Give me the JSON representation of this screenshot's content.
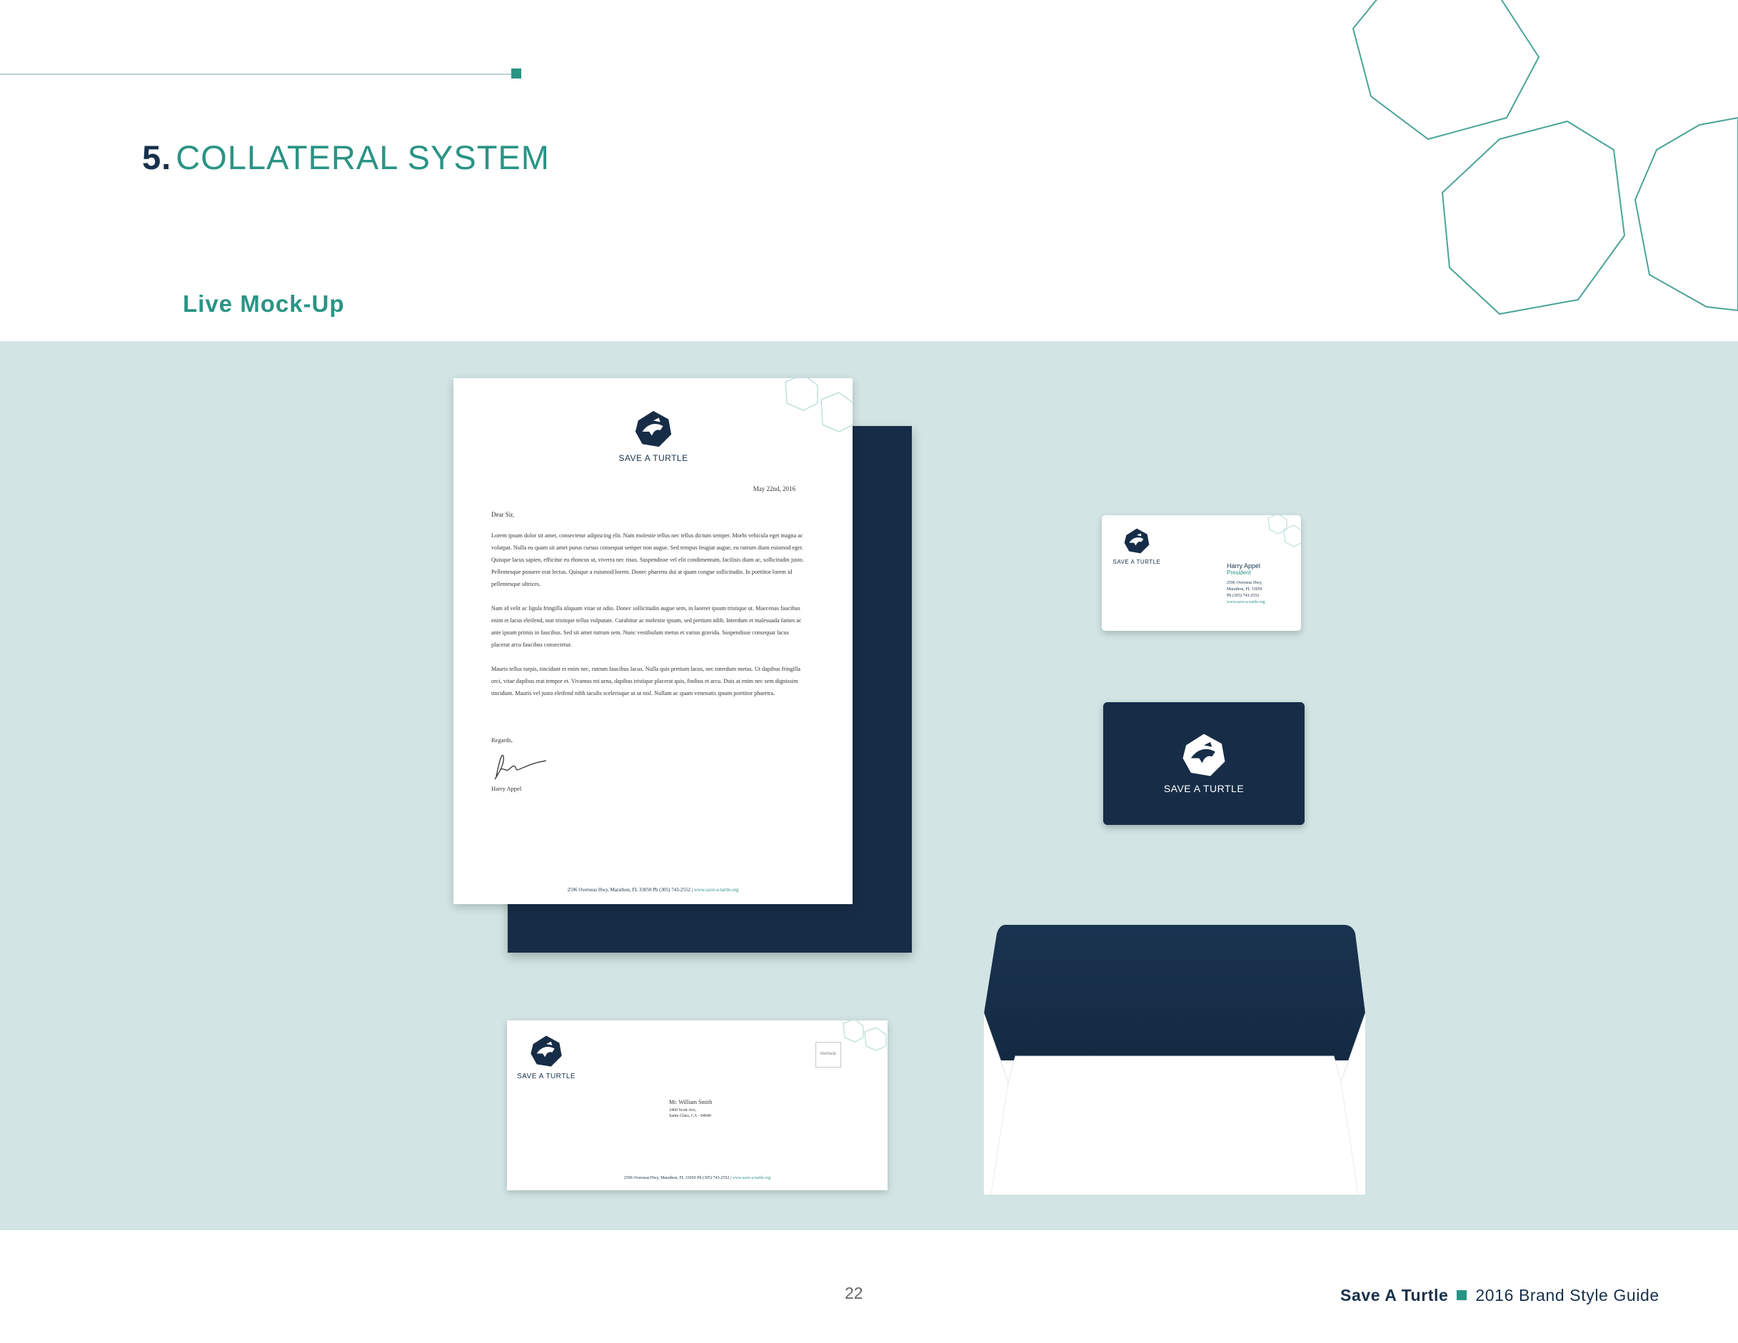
{
  "section": {
    "number": "5.",
    "title": "COLLATERAL SYSTEM"
  },
  "subtitle": "Live Mock-Up",
  "colors": {
    "navy": "#172d47",
    "teal": "#2a9485",
    "mockup_background": "#d2e5e4"
  },
  "brand_name": "SAVE A TURTLE",
  "letterhead": {
    "date": "May 22nd, 2016",
    "salutation": "Dear Sir,",
    "paragraphs": [
      "Lorem ipsum dolor sit amet, consectetur adipiscing elit. Nam molestie tellus nec tellus dictum semper. Morbi vehicula eget magna ac volutpat. Nulla eu quam sit amet purus cursus consequat semper non augue. Sed tempus feugiat augue, eu rutrum diam euismod eget. Quisque lacus sapien, efficitur eu rhoncus ut, viverra nec risus. Suspendisse vel elit condimentum, facilisis diam ac, sollicitudin justo. Pellentesque posuere erat lectus. Quisque a euismod lorem. Donec pharetra dui at quam congue sollicitudin. In porttitor lorem id pellentesque ultrices.",
      "Nam id velit ac ligula fringilla aliquam vitae ut odio. Donec sollicitudin augue sem, in laoreet ipsum tristique ut. Maecenas faucibus enim et lacus eleifend, non tristique tellus vulputate. Curabitur ac molestie ipsum, sed pretium nibh. Interdum et malesuada fames ac ante ipsum primis in faucibus. Sed sit amet rutrum sem. Nunc vestibulum metus et varius gravida. Suspendisse consequat lacus placerat arcu faucibus consectetur.",
      "Mauris tellus turpis, tincidunt et enim nec, rutrum faucibus lacus. Nulla quis pretium lacus, nec interdum metus. Ut dapibus fringilla orci, vitae dapibus erat tempor et. Vivamus mi urna, dapibus tristique placerat quis, finibus et arcu. Duis at enim nec sem dignissim tincidunt. Mauris vel justo eleifend nibh iaculis scelerisque ut ut nisl. Nullam ac quam venenatis ipsum porttitor pharetra."
    ],
    "closing": "Regards,",
    "signer": "Harry Appel",
    "footer_address": "2596 Overseas Hwy, Marathon, FL 33050   Ph (305) 743-2552",
    "footer_separator": "|",
    "footer_url": "www.save-a-turtle.org"
  },
  "business_card": {
    "name": "Harry Appel",
    "role": "President",
    "address_line1": "2596 Overseas Hwy,",
    "address_line2": "Marathon, FL 33050",
    "phone": "Ph (305) 743-2552",
    "url": "www.save-a-turtle.org"
  },
  "envelope": {
    "postage": "POSTAGE",
    "recipient_name": "Mr. William Smith",
    "recipient_line1": "2460 Scott Ave,",
    "recipient_line2": "Santa Clara, CA - 94040",
    "footer_address": "2596 Overseas Hwy, Marathon, FL 33050   Ph (305) 743-2552",
    "footer_separator": "|",
    "footer_url": "www.save-a-turtle.org"
  },
  "page_number": "22",
  "footer": {
    "brand": "Save A Turtle",
    "guide": "2016 Brand Style Guide"
  }
}
